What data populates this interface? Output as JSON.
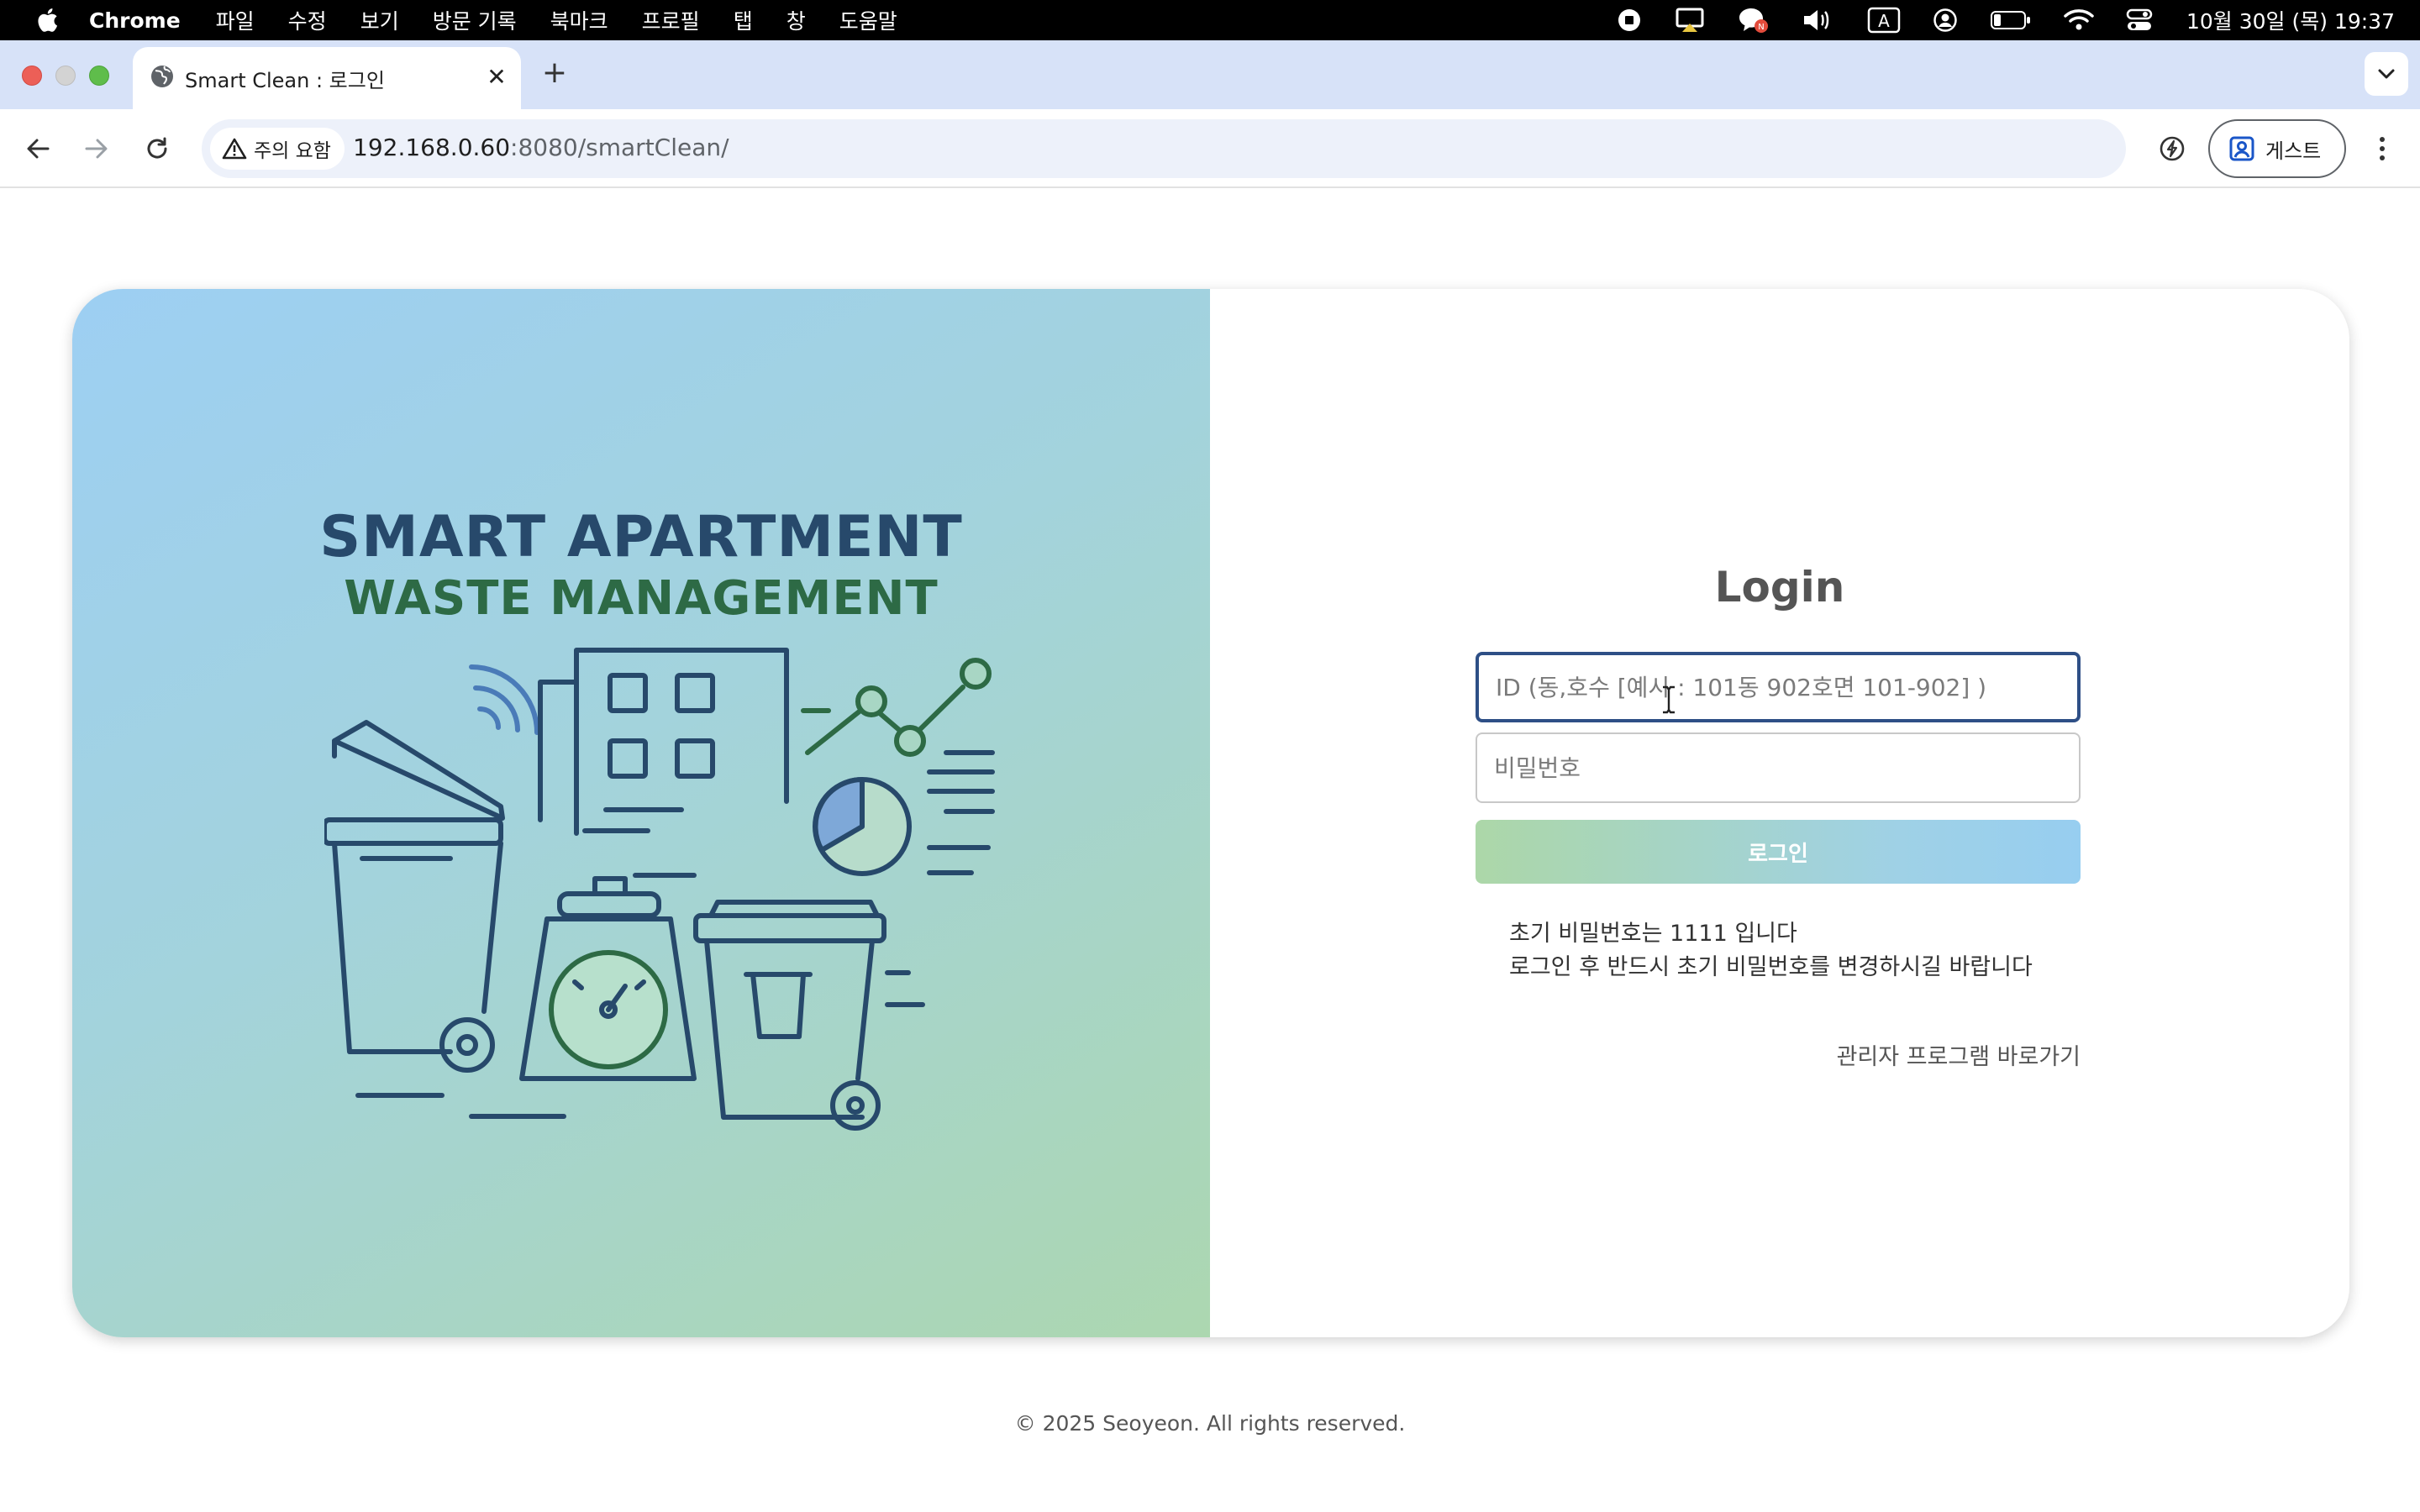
{
  "menubar": {
    "app_name": "Chrome",
    "menus": [
      "파일",
      "수정",
      "보기",
      "방문 기록",
      "북마크",
      "프로필",
      "탭",
      "창",
      "도움말"
    ],
    "input_indicator": "A",
    "clock": "10월 30일 (목) 19:37"
  },
  "tab": {
    "title": "Smart Clean : 로그인",
    "close_glyph": "✕",
    "new_tab_glyph": "+"
  },
  "toolbar": {
    "security_warning": "주의 요함",
    "url_host": "192.168.0.60",
    "url_rest": ":8080/smartClean/",
    "profile_label": "게스트"
  },
  "hero": {
    "title_line1": "SMART APARTMENT",
    "title_line2": "WASTE MANAGEMENT",
    "colors": {
      "navy": "#27496b",
      "green": "#2d6a45",
      "pie_fill": "#7ea8d8"
    }
  },
  "login": {
    "title": "Login",
    "id_placeholder": "ID (동,호수 [예시 : 101동 902호면 101-902] )",
    "id_value": "",
    "password_placeholder": "비밀번호",
    "password_value": "",
    "button_label": "로그인",
    "notice_line1": "초기 비밀번호는 1111 입니다",
    "notice_line2": "로그인 후 반드시 초기 비밀번호를 변경하시길 바랍니다",
    "admin_link": "관리자 프로그램 바로가기"
  },
  "footer": {
    "copyright": "© 2025 Seoyeon. All rights reserved."
  }
}
